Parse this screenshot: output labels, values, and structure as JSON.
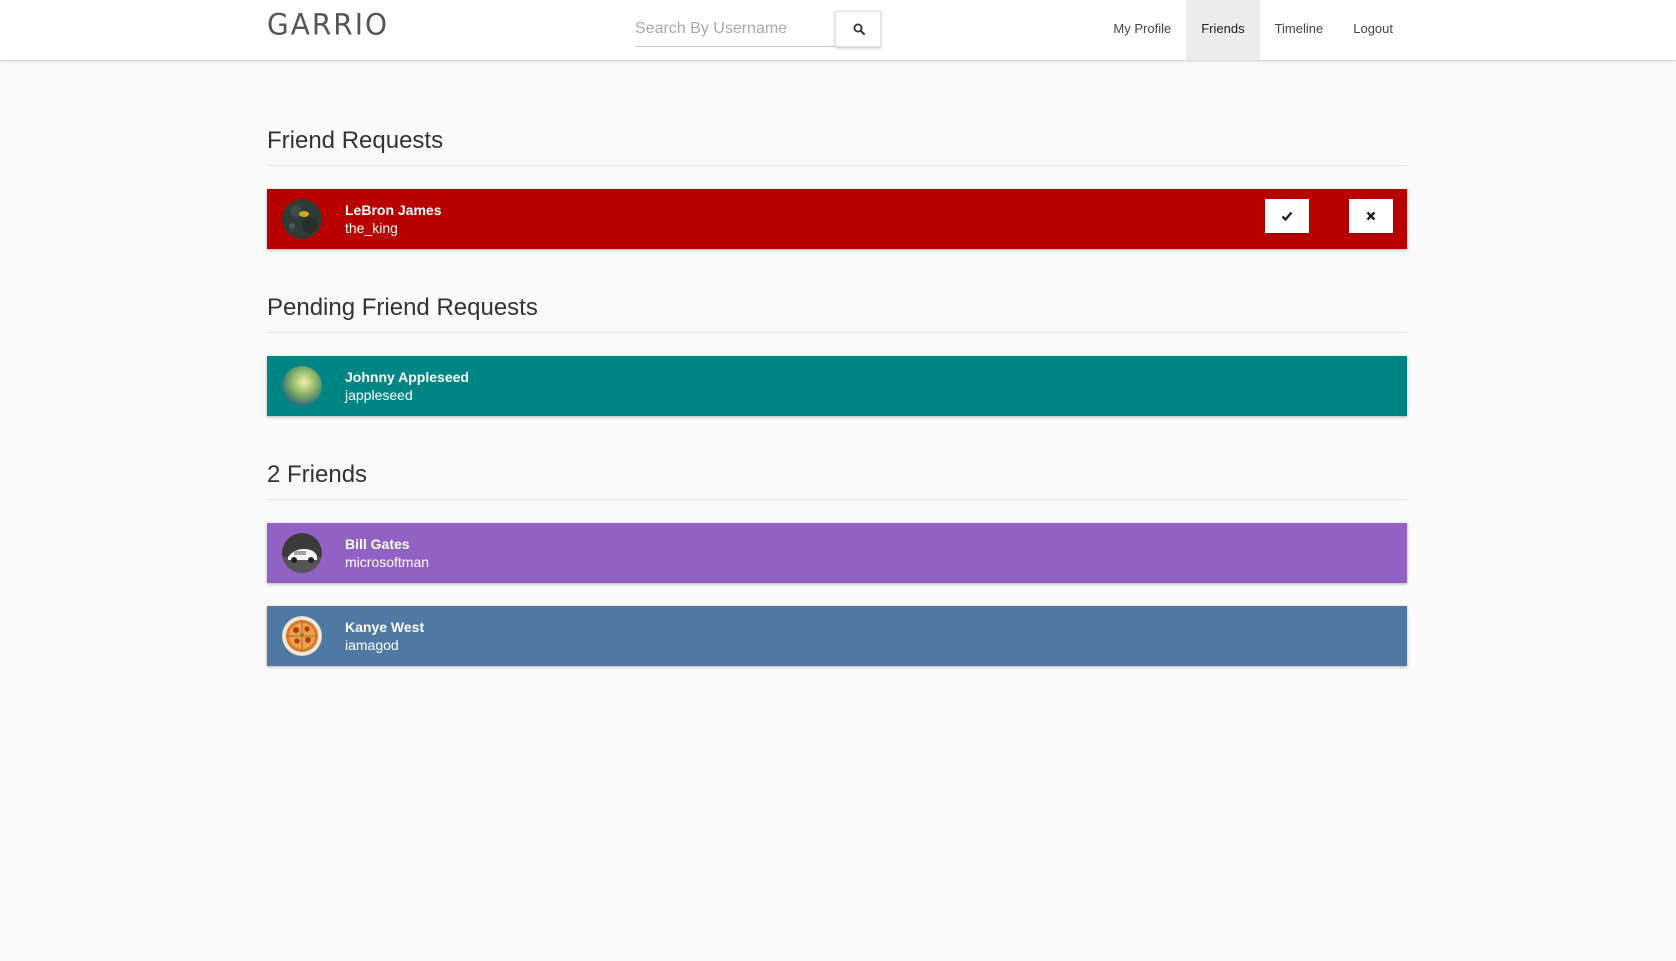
{
  "navbar": {
    "brand": "GARRIO",
    "search": {
      "placeholder": "Search By Username",
      "value": ""
    },
    "links": [
      {
        "label": "My Profile",
        "active": false
      },
      {
        "label": "Friends",
        "active": true
      },
      {
        "label": "Timeline",
        "active": false
      },
      {
        "label": "Logout",
        "active": false
      }
    ]
  },
  "sections": {
    "friend_requests": {
      "title": "Friend Requests",
      "items": [
        {
          "name": "LeBron James",
          "username": "the_king",
          "color": "#b80000"
        }
      ]
    },
    "pending_requests": {
      "title": "Pending Friend Requests",
      "items": [
        {
          "name": "Johnny Appleseed",
          "username": "jappleseed",
          "color": "#008585"
        }
      ]
    },
    "friends": {
      "title": "2 Friends",
      "items": [
        {
          "name": "Bill Gates",
          "username": "microsoftman",
          "color": "#9162c4"
        },
        {
          "name": "Kanye West",
          "username": "iamagod",
          "color": "#4f79a3"
        }
      ]
    }
  },
  "icons": {
    "search": "search-icon",
    "accept": "check-icon",
    "decline": "close-icon"
  }
}
